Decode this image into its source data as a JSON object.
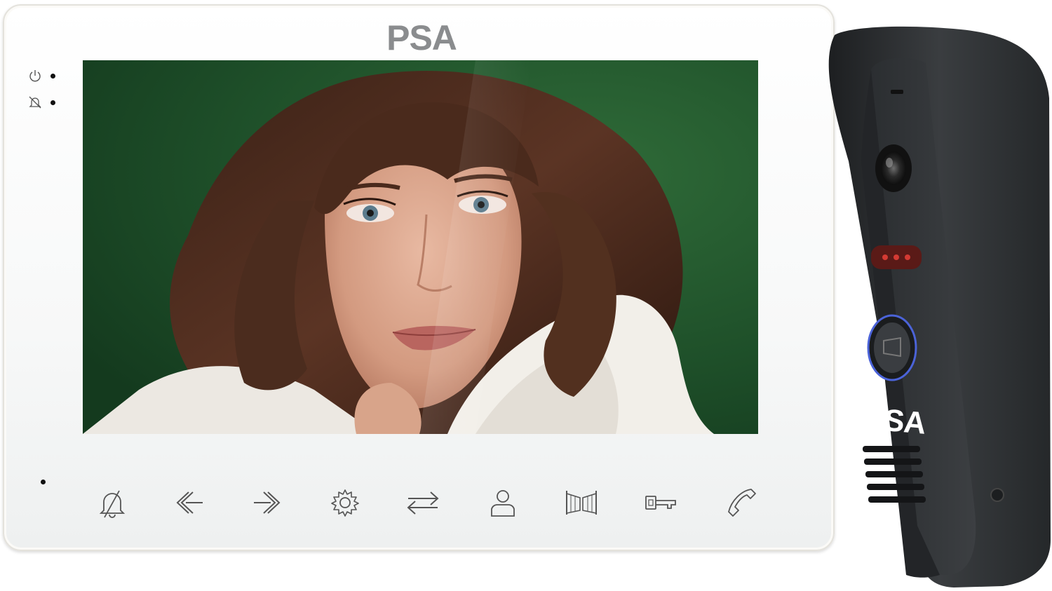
{
  "monitor": {
    "brand": "PSA",
    "status_icons": [
      "power-icon",
      "mute-icon"
    ],
    "buttons": [
      {
        "name": "mute-bell-button",
        "icon": "bell-off-icon"
      },
      {
        "name": "back-button",
        "icon": "arrow-left-icon"
      },
      {
        "name": "forward-button",
        "icon": "arrow-right-icon"
      },
      {
        "name": "settings-button",
        "icon": "gear-icon"
      },
      {
        "name": "transfer-button",
        "icon": "swap-arrows-icon"
      },
      {
        "name": "monitor-button",
        "icon": "person-icon"
      },
      {
        "name": "gate-button",
        "icon": "gate-icon"
      },
      {
        "name": "unlock-button",
        "icon": "key-icon"
      },
      {
        "name": "talk-button",
        "icon": "phone-handset-icon"
      }
    ]
  },
  "door_station": {
    "brand": "PSA",
    "components": [
      "camera-lens-icon",
      "infrared-led-icon",
      "call-button-icon",
      "speaker-grille"
    ]
  },
  "colors": {
    "monitor_body": "#ffffff",
    "logo_grey": "#8a8c8e",
    "door_body": "#2b2e31",
    "led_red": "#d43a33",
    "call_ring_blue": "#4b63d8"
  }
}
